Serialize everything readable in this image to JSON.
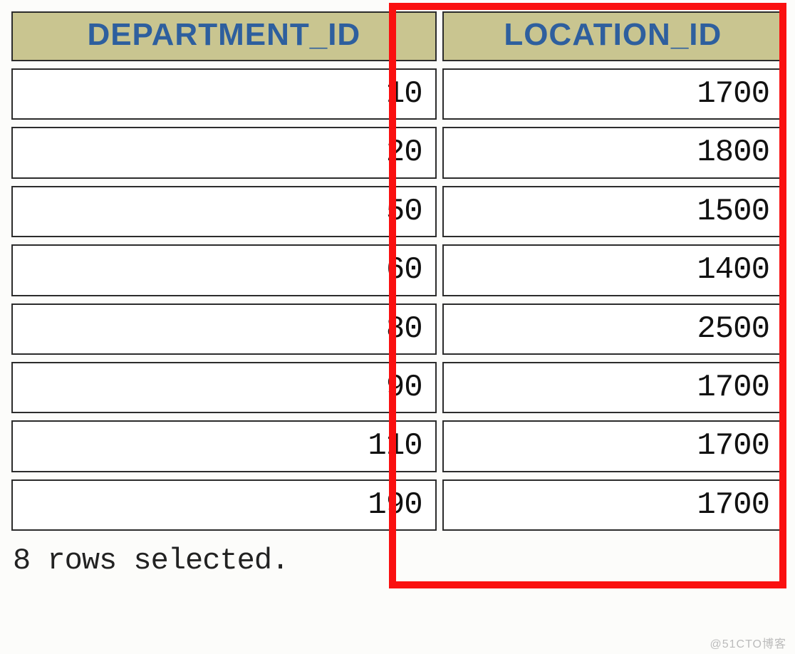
{
  "table": {
    "columns": [
      "DEPARTMENT_ID",
      "LOCATION_ID"
    ],
    "rows": [
      {
        "department_id": "10",
        "location_id": "1700"
      },
      {
        "department_id": "20",
        "location_id": "1800"
      },
      {
        "department_id": "50",
        "location_id": "1500"
      },
      {
        "department_id": "60",
        "location_id": "1400"
      },
      {
        "department_id": "80",
        "location_id": "2500"
      },
      {
        "department_id": "90",
        "location_id": "1700"
      },
      {
        "department_id": "110",
        "location_id": "1700"
      },
      {
        "department_id": "190",
        "location_id": "1700"
      }
    ]
  },
  "status_text": "8 rows selected.",
  "watermark": "@51CTO博客",
  "highlighted_column_index": 1,
  "accent": {
    "highlight_border": "#fa1010",
    "header_bg": "#c9c590",
    "header_fg": "#2e5f9e"
  }
}
